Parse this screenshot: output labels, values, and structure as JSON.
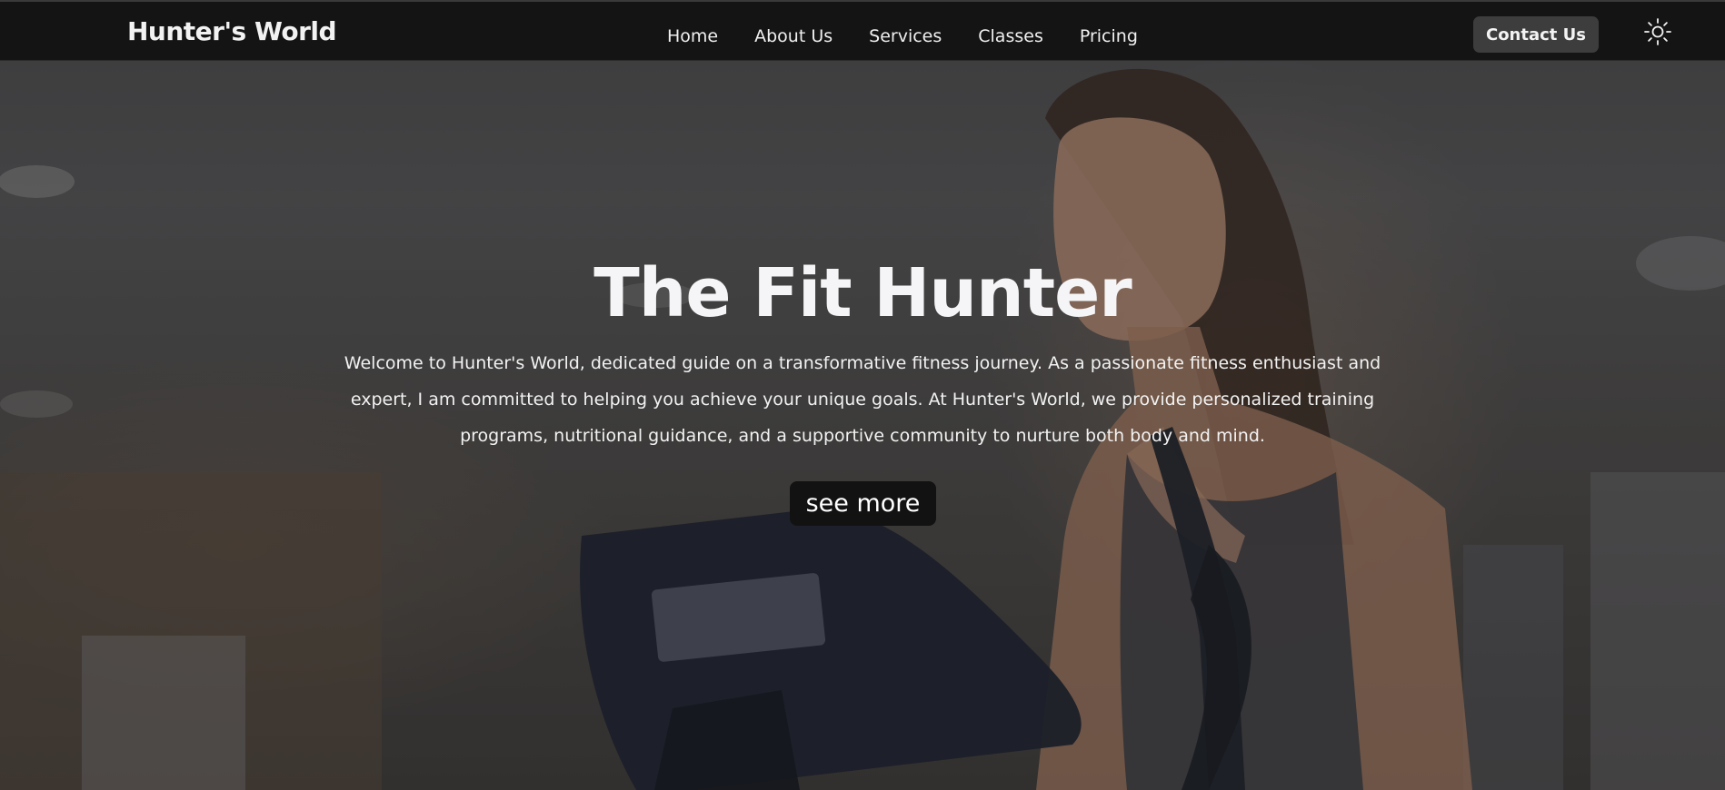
{
  "navbar": {
    "brand": "Hunter's World",
    "links": [
      {
        "label": "Home"
      },
      {
        "label": "About Us"
      },
      {
        "label": "Services"
      },
      {
        "label": "Classes"
      },
      {
        "label": "Pricing"
      }
    ],
    "contact_label": "Contact Us",
    "theme_icon": "sun-icon"
  },
  "hero": {
    "title": "The Fit Hunter",
    "description": "Welcome to Hunter's World, dedicated guide on a transformative fitness journey. As a passionate fitness enthusiast and expert, I am committed to helping you achieve your unique goals. At Hunter's World, we provide personalized training programs, nutritional guidance, and a supportive community to nurture both body and mind.",
    "cta_label": "see more",
    "background_image": "woman-on-elliptical-gym-photo"
  },
  "colors": {
    "navbar_bg": "#141414",
    "contact_button_bg": "#3d3d3d",
    "cta_button_bg": "#121212",
    "text": "#f2f2f2"
  }
}
